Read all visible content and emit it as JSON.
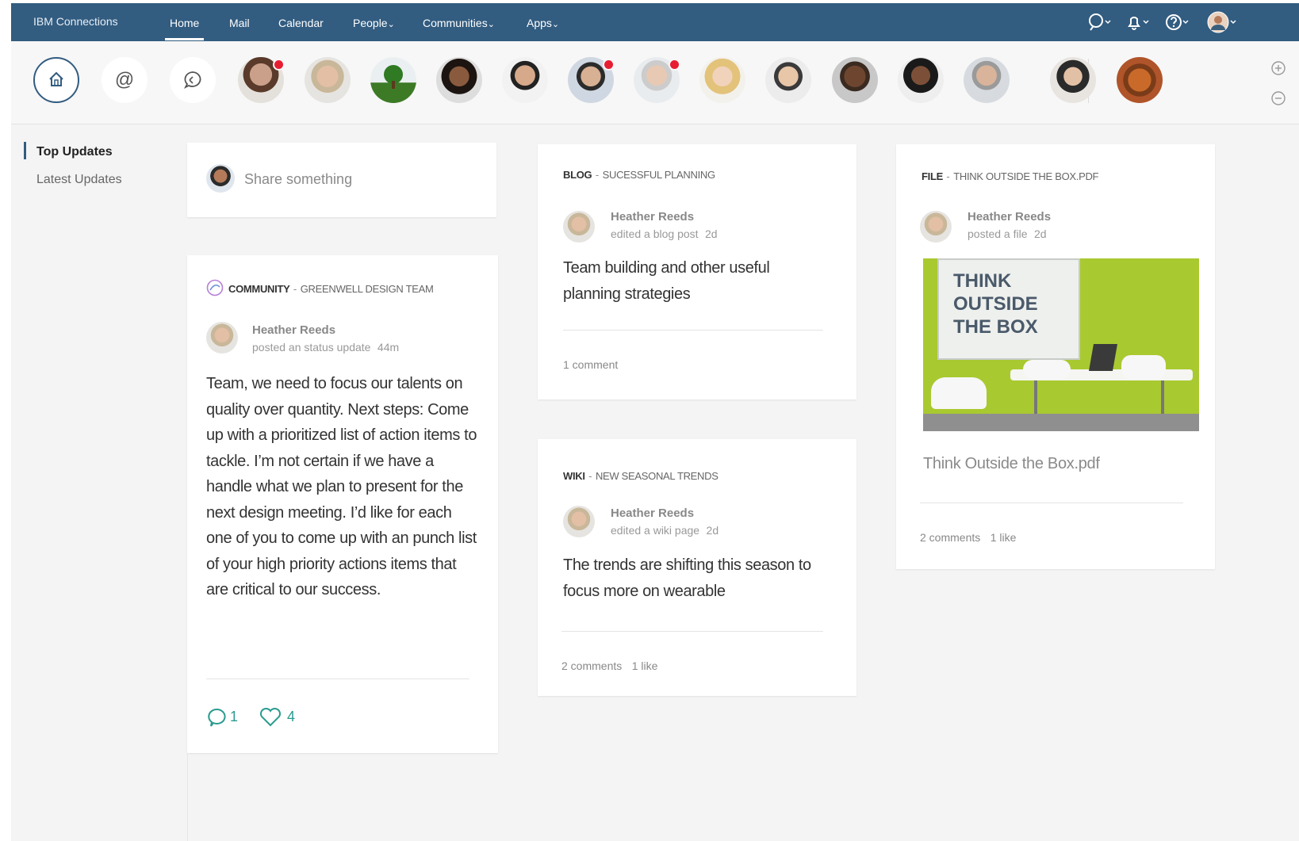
{
  "app": {
    "title": "IBM Connections"
  },
  "nav": {
    "items": [
      {
        "label": "Home"
      },
      {
        "label": "Mail"
      },
      {
        "label": "Calendar"
      },
      {
        "label": "People",
        "chevron": "⌄"
      },
      {
        "label": "Communities",
        "chevron": "⌄"
      },
      {
        "label": "Apps",
        "chevron": "⌄"
      }
    ],
    "icons": [
      "search-icon",
      "bell-icon",
      "help-icon",
      "user-menu-icon"
    ]
  },
  "strip": {
    "shortcuts": [
      "home-icon",
      "at-mention-icon",
      "chat-bubble-icon"
    ],
    "at_symbol": "@",
    "people_count": 14,
    "people_with_notification": [
      1,
      6,
      7
    ]
  },
  "leftnav": {
    "items": [
      {
        "label": "Top Updates"
      },
      {
        "label": "Latest Updates"
      }
    ]
  },
  "share": {
    "placeholder": "Share something"
  },
  "cards": {
    "community": {
      "type": "COMMUNITY",
      "sep": "-",
      "name": "GREENWELL DESIGN TEAM",
      "author": "Heather Reeds",
      "action": "posted an status update",
      "time": "44m",
      "body": "Team, we need to focus our talents on quality over quantity. Next steps: Come up with a prioritized list of action items to tackle. I’m not certain if we have a handle what we plan to present for the next design meeting. I’d like for each one of you to come up with an punch list of your high priority actions items that are critical to our success.",
      "comments": "1",
      "likes": "4"
    },
    "blog": {
      "type": "BLOG",
      "sep": "-",
      "name": "SUCESSFUL PLANNING",
      "author": "Heather Reeds",
      "action": "edited a blog post",
      "time": "2d",
      "body": "Team building and other useful planning strategies",
      "footer": "1 comment"
    },
    "wiki": {
      "type": "WIKI",
      "sep": "-",
      "name": "NEW SEASONAL TRENDS",
      "author": "Heather Reeds",
      "action": "edited a wiki page",
      "time": "2d",
      "body": "The trends are shifting this season to focus more on wearable",
      "comments": "2 comments",
      "likes": "1 like"
    },
    "file": {
      "type": "FILE",
      "sep": "-",
      "name": "THINK OUTSIDE THE BOX.PDF",
      "author": "Heather Reeds",
      "action": "posted a file",
      "time": "2d",
      "image_text": [
        "THINK",
        "OUTSIDE",
        "THE BOX"
      ],
      "filename": "Think Outside the Box.pdf",
      "comments": "2 comments",
      "likes": "1 like"
    }
  },
  "colors": {
    "nav_bg": "#325c80",
    "notification": "#e71d32",
    "accent_teal": "#2b9b8f",
    "page_bg": "#f4f4f4"
  }
}
